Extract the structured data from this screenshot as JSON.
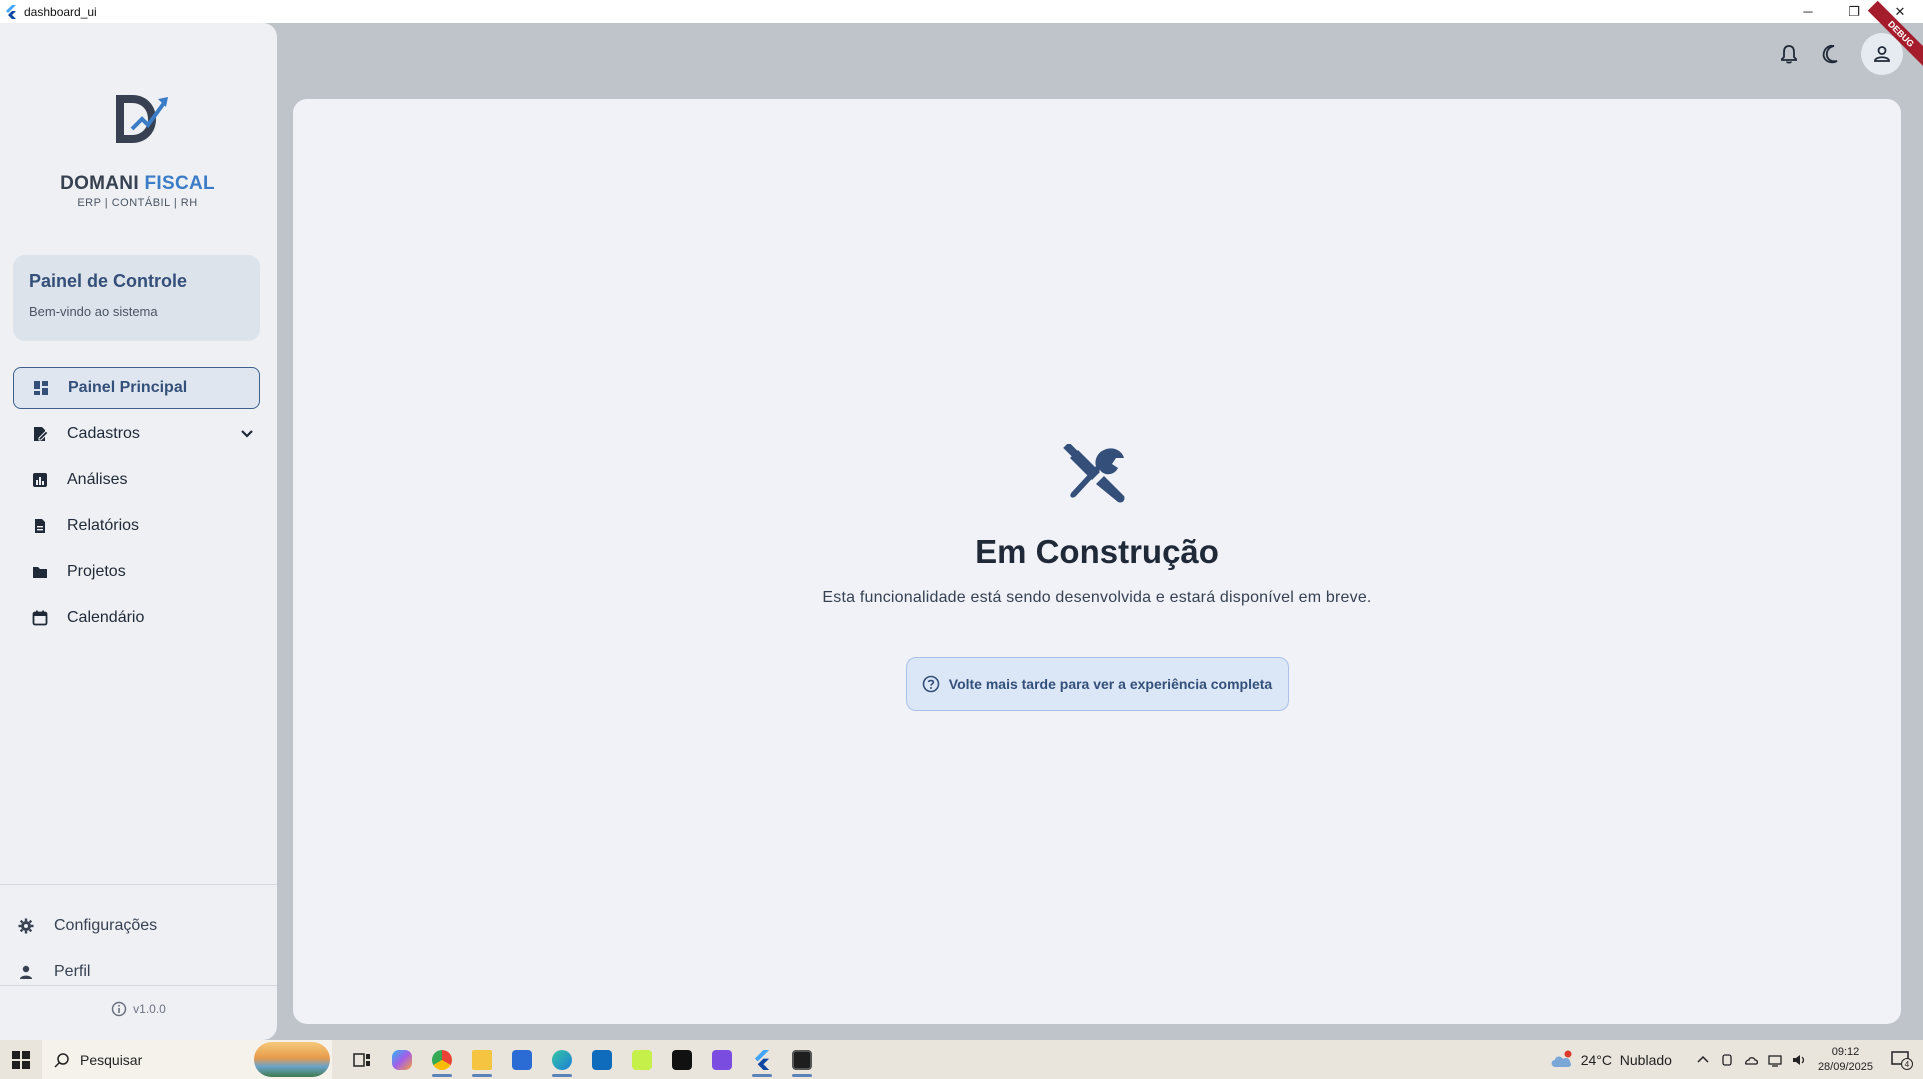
{
  "window": {
    "title": "dashboard_ui",
    "minimize": "─",
    "restore": "❐",
    "close": "✕"
  },
  "logo": {
    "name_main": "DOMANI",
    "name_accent": "FISCAL",
    "tagline": "ERP | CONTÁBIL | RH"
  },
  "panel": {
    "title": "Painel de Controle",
    "subtitle": "Bem-vindo ao sistema"
  },
  "nav": {
    "items": [
      {
        "label": "Painel Principal",
        "icon": "dashboard-icon",
        "active": true
      },
      {
        "label": "Cadastros",
        "icon": "edit-document-icon",
        "expandable": true
      },
      {
        "label": "Análises",
        "icon": "analytics-icon"
      },
      {
        "label": "Relatórios",
        "icon": "description-icon"
      },
      {
        "label": "Projetos",
        "icon": "folder-icon"
      },
      {
        "label": "Calendário",
        "icon": "calendar-icon"
      }
    ]
  },
  "bottom_nav": {
    "settings": "Configurações",
    "profile": "Perfil",
    "version": "v1.0.0"
  },
  "header": {
    "debug_badge": "DEBUG"
  },
  "main": {
    "heading": "Em Construção",
    "description": "Esta funcionalidade está sendo desenvolvida e estará disponível em breve.",
    "notice": "Volte mais tarde para ver a experiência completa"
  },
  "taskbar": {
    "search_placeholder": "Pesquisar",
    "weather": {
      "temperature": "24°C",
      "condition": "Nublado"
    },
    "clock": {
      "time": "09:12",
      "date": "28/09/2025"
    },
    "notification_count": "4"
  },
  "colors": {
    "accent": "#34507a",
    "logo_blue": "#3b7cc7",
    "sidebar_bg": "#eef0f3",
    "content_bg": "#f0f2f8",
    "app_bg": "#bfc4cb",
    "debug_red": "#a51d2d"
  }
}
